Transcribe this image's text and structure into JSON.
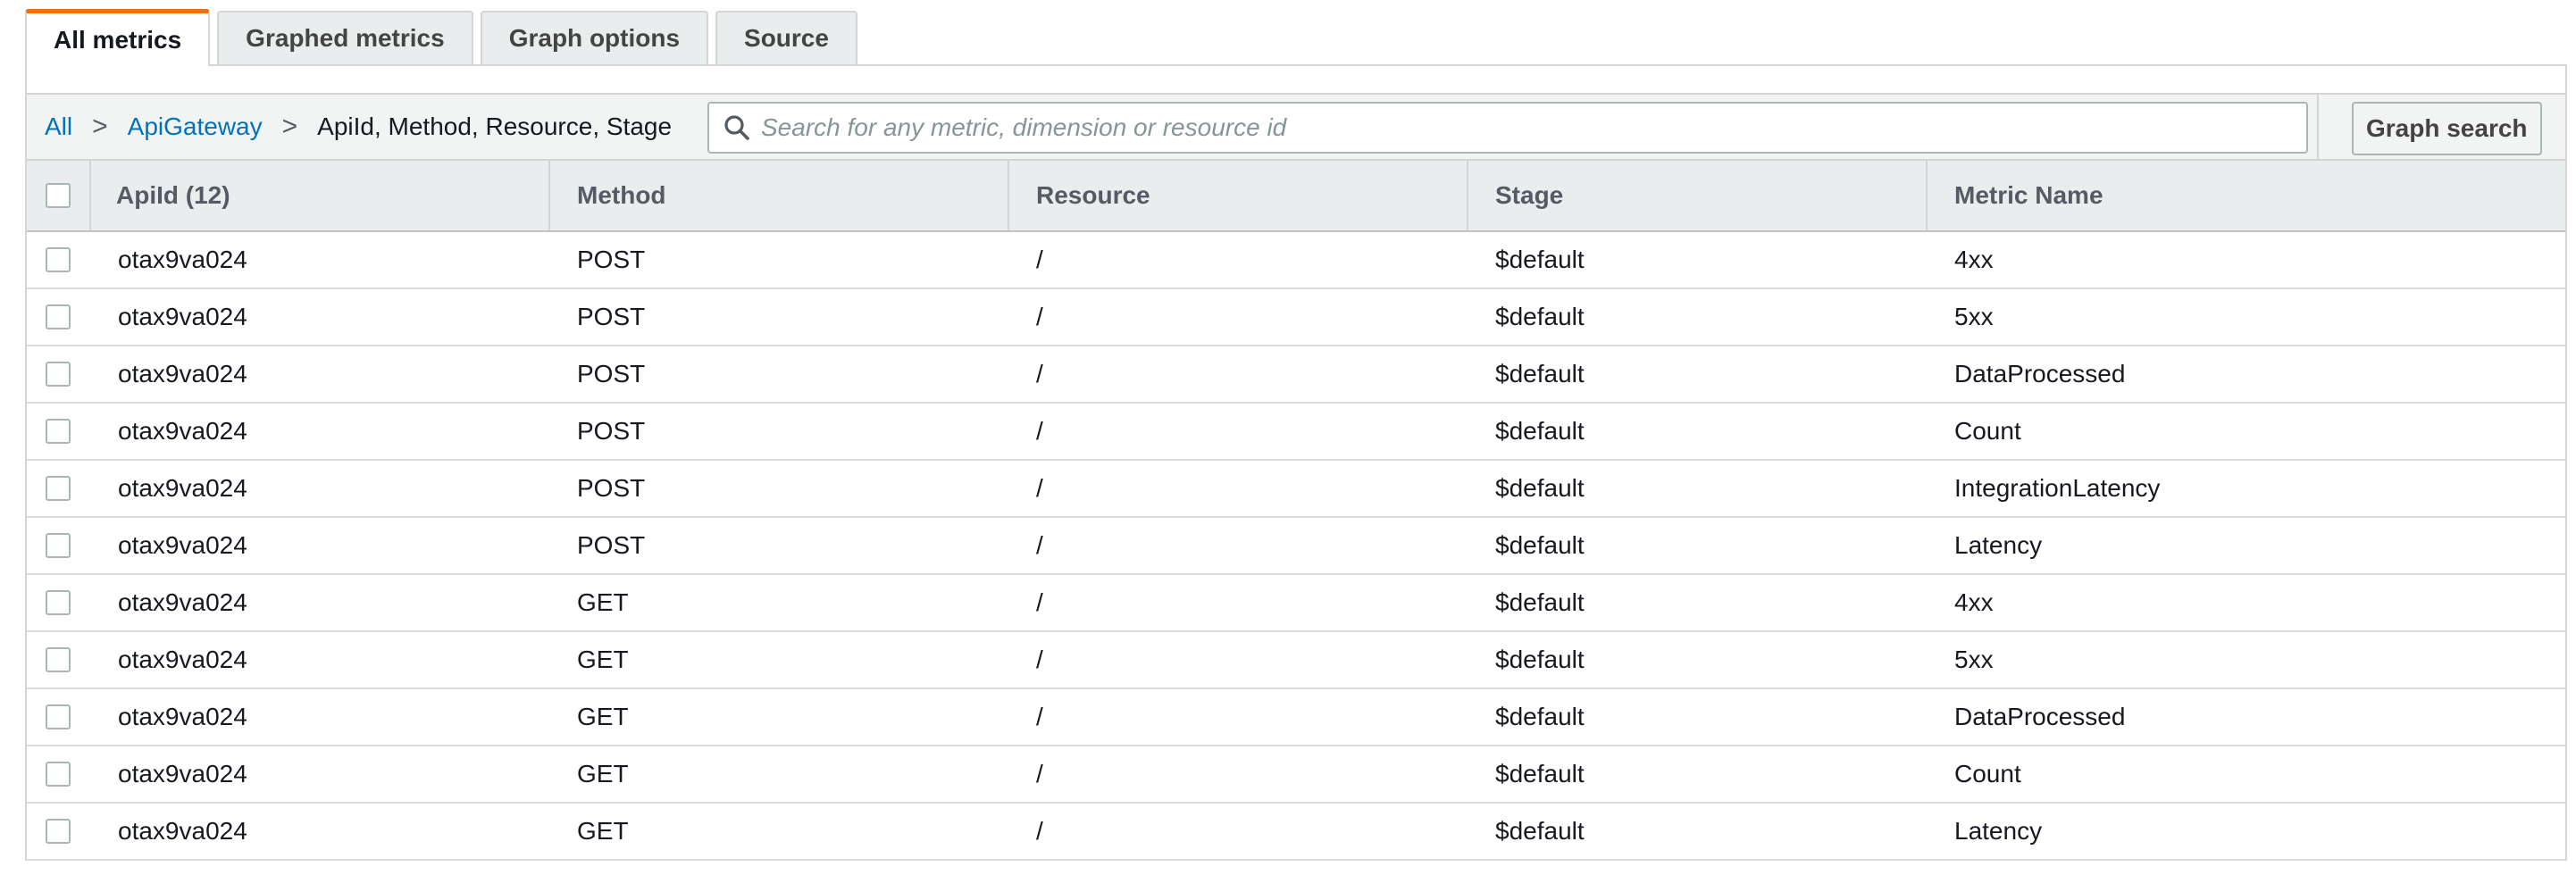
{
  "tabs": [
    {
      "label": "All metrics",
      "active": true
    },
    {
      "label": "Graphed metrics",
      "active": false
    },
    {
      "label": "Graph options",
      "active": false
    },
    {
      "label": "Source",
      "active": false
    }
  ],
  "breadcrumb": {
    "root": "All",
    "separator": ">",
    "namespace": "ApiGateway",
    "dimensions": "ApiId, Method, Resource, Stage"
  },
  "search": {
    "placeholder": "Search for any metric, dimension or resource id",
    "value": "",
    "icon": "search-icon"
  },
  "graph_search_label": "Graph search",
  "table": {
    "columns": [
      "ApiId  (12)",
      "Method",
      "Resource",
      "Stage",
      "Metric Name"
    ],
    "rows": [
      {
        "api_id": "otax9va024",
        "method": "POST",
        "resource": "/",
        "stage": "$default",
        "metric": "4xx"
      },
      {
        "api_id": "otax9va024",
        "method": "POST",
        "resource": "/",
        "stage": "$default",
        "metric": "5xx"
      },
      {
        "api_id": "otax9va024",
        "method": "POST",
        "resource": "/",
        "stage": "$default",
        "metric": "DataProcessed"
      },
      {
        "api_id": "otax9va024",
        "method": "POST",
        "resource": "/",
        "stage": "$default",
        "metric": "Count"
      },
      {
        "api_id": "otax9va024",
        "method": "POST",
        "resource": "/",
        "stage": "$default",
        "metric": "IntegrationLatency"
      },
      {
        "api_id": "otax9va024",
        "method": "POST",
        "resource": "/",
        "stage": "$default",
        "metric": "Latency"
      },
      {
        "api_id": "otax9va024",
        "method": "GET",
        "resource": "/",
        "stage": "$default",
        "metric": "4xx"
      },
      {
        "api_id": "otax9va024",
        "method": "GET",
        "resource": "/",
        "stage": "$default",
        "metric": "5xx"
      },
      {
        "api_id": "otax9va024",
        "method": "GET",
        "resource": "/",
        "stage": "$default",
        "metric": "DataProcessed"
      },
      {
        "api_id": "otax9va024",
        "method": "GET",
        "resource": "/",
        "stage": "$default",
        "metric": "Count"
      },
      {
        "api_id": "otax9va024",
        "method": "GET",
        "resource": "/",
        "stage": "$default",
        "metric": "Latency"
      }
    ]
  },
  "colors": {
    "accent_tab": "#ec7211",
    "link": "#0073bb",
    "header_bg": "#eaeded",
    "toolbar_bg": "#f2f3f3"
  }
}
